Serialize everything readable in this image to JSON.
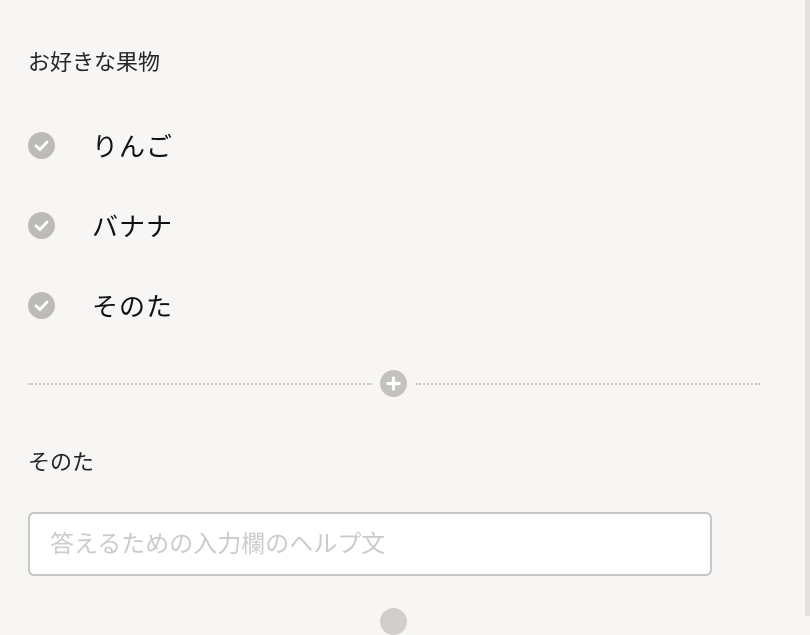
{
  "question1": {
    "title": "お好きな果物",
    "options": [
      {
        "label": "りんご"
      },
      {
        "label": "バナナ"
      },
      {
        "label": "そのた"
      }
    ]
  },
  "question2": {
    "title": "そのた",
    "input": {
      "placeholder": "答えるための入力欄のヘルプ文",
      "value": ""
    }
  },
  "icons": {
    "option": "check-circle-icon",
    "add": "plus-circle-icon"
  },
  "colors": {
    "background": "#f7f6f4",
    "icon": "#bdbbb8",
    "input_border": "#c9c7c3",
    "placeholder": "#cdcbc8"
  }
}
